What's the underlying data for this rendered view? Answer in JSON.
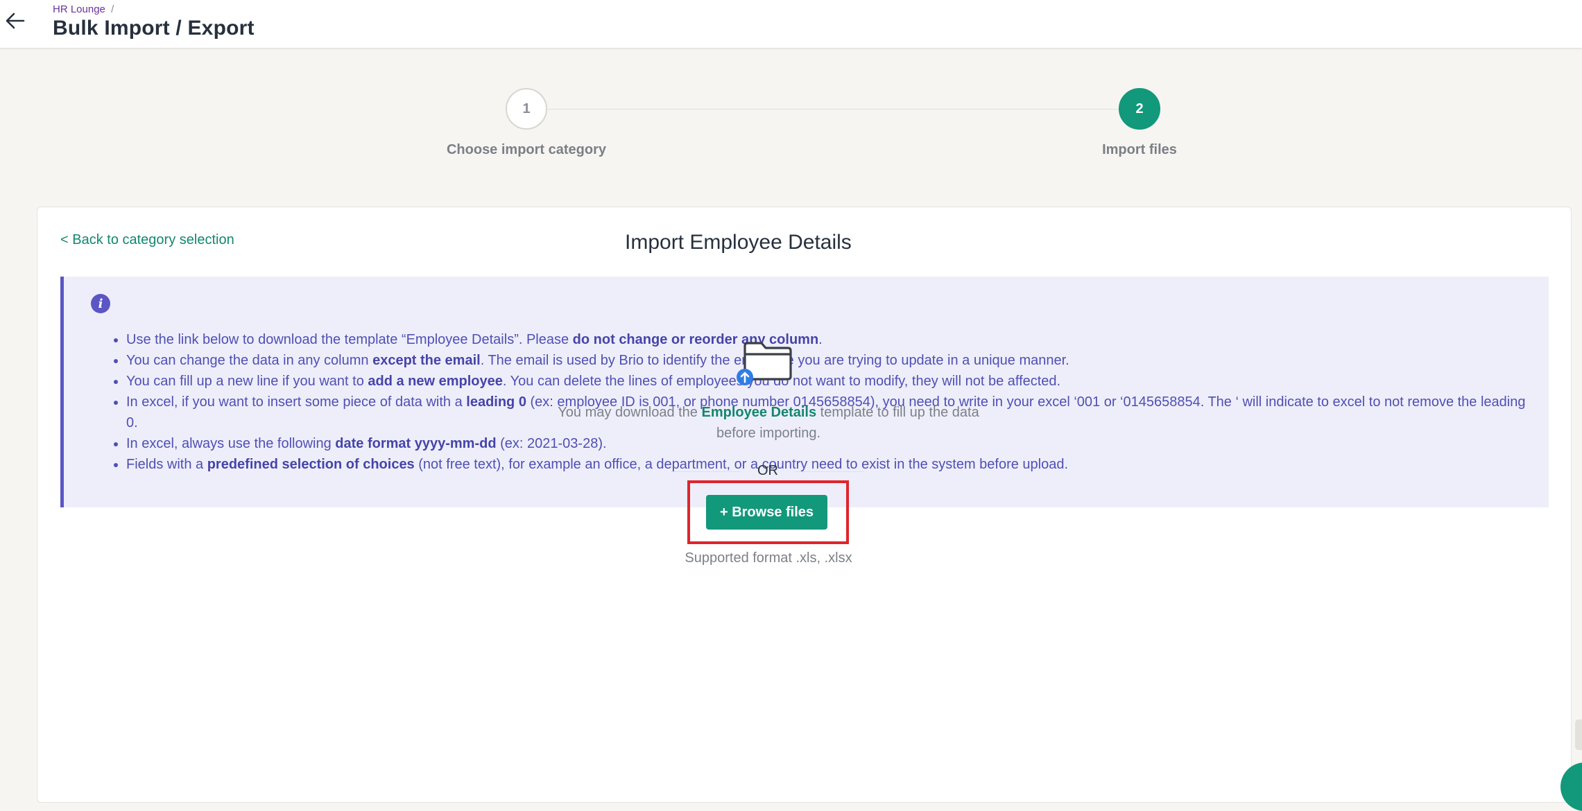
{
  "header": {
    "breadcrumb": "HR Lounge",
    "breadcrumb_separator": "/",
    "title": "Bulk Import / Export"
  },
  "stepper": {
    "steps": [
      {
        "number": "1",
        "label": "Choose import category",
        "state": "done"
      },
      {
        "number": "2",
        "label": "Import files",
        "state": "active"
      }
    ]
  },
  "card": {
    "back_link": "< Back to category selection",
    "title": "Import Employee Details"
  },
  "info": {
    "icon": "info-icon",
    "items": [
      [
        {
          "t": "Use the link below to download the template “Employee Details”. Please ",
          "b": false
        },
        {
          "t": "do not change or reorder any column",
          "b": true
        },
        {
          "t": ".",
          "b": false
        }
      ],
      [
        {
          "t": "You can change the data in any column ",
          "b": false
        },
        {
          "t": "except the email",
          "b": true
        },
        {
          "t": ". The email is used by Brio to identify the employee you are trying to update in a unique manner.",
          "b": false
        }
      ],
      [
        {
          "t": "You can fill up a new line if you want to ",
          "b": false
        },
        {
          "t": "add a new employee",
          "b": true
        },
        {
          "t": ". You can delete the lines of employees you do not want to modify, they will not be affected.",
          "b": false
        }
      ],
      [
        {
          "t": "In excel, if you want to insert some piece of data with a ",
          "b": false
        },
        {
          "t": "leading 0",
          "b": true
        },
        {
          "t": " (ex: employee ID is 001, or phone number 0145658854), you need to write in your excel ‘001 or ‘0145658854. The ‘ will indicate to excel to not remove the leading 0.",
          "b": false
        }
      ],
      [
        {
          "t": "In excel, always use the following ",
          "b": false
        },
        {
          "t": "date format yyyy-mm-dd",
          "b": true
        },
        {
          "t": " (ex: 2021-03-28).",
          "b": false
        }
      ],
      [
        {
          "t": "Fields with a ",
          "b": false
        },
        {
          "t": "predefined selection of choices",
          "b": true
        },
        {
          "t": " (not free text), for example an office, a department, or a country need to exist in the system before upload.",
          "b": false
        }
      ]
    ]
  },
  "upload": {
    "icon": "folder-upload-icon",
    "download_prefix": "You may download the ",
    "download_link": "Employee Details",
    "download_suffix": " template to fill up the data before importing.",
    "or_label": "OR",
    "browse_label": "+ Browse files",
    "supported": "Supported format .xls, .xlsx"
  },
  "colors": {
    "accent": "#12987b",
    "info_text": "#4f4fb3",
    "info_bg": "#eeeefb",
    "highlight": "#e0242c"
  }
}
